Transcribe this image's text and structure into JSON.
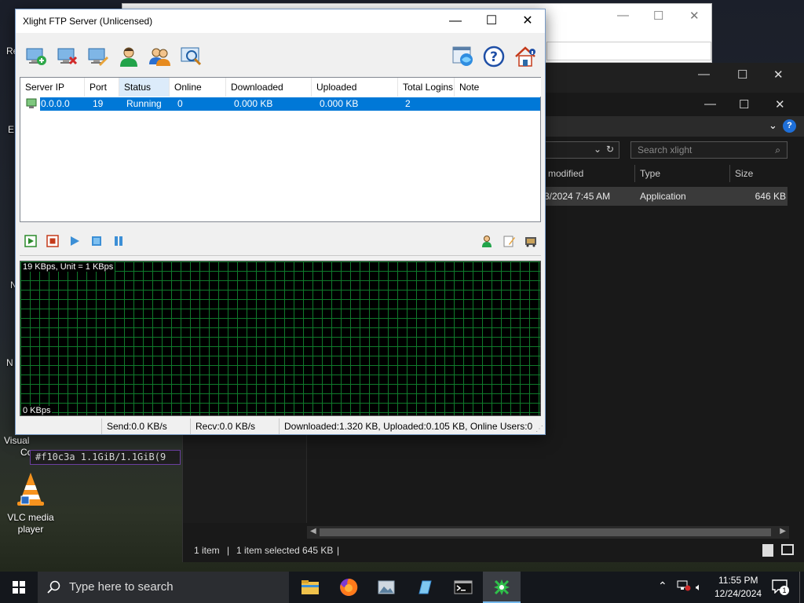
{
  "desktop": {
    "icons": [
      {
        "label": "VLC media player"
      }
    ],
    "partial_labels": [
      "Re",
      "E",
      "N",
      "N",
      "Visual",
      "Co"
    ],
    "terminal_strip": "#f10c3a 1.1GiB/1.1GiB(9"
  },
  "explorer": {
    "search_placeholder": "Search xlight",
    "columns": [
      "modified",
      "Type",
      "Size"
    ],
    "file": {
      "modified": "3/2024 7:45 AM",
      "type": "Application",
      "size": "646 KB"
    },
    "status": {
      "count": "1 item",
      "selected": "1 item selected  645 KB"
    }
  },
  "xlight": {
    "title": "Xlight FTP Server (Unlicensed)",
    "toolbar_icons": [
      "add-server-icon",
      "delete-server-icon",
      "edit-server-icon",
      "user-icon",
      "users-group-icon",
      "search-icon",
      "global-settings-icon",
      "help-icon",
      "home-info-icon"
    ],
    "list": {
      "headers": [
        "Server IP",
        "Port",
        "Status",
        "Online Users",
        "Downloaded",
        "Uploaded",
        "Total Logins",
        "Note"
      ],
      "rows": [
        {
          "ip": "0.0.0.0",
          "port": "19",
          "status": "Running",
          "online": "0",
          "downloaded": "0.000 KB",
          "uploaded": "0.000 KB",
          "logins": "2",
          "note": ""
        }
      ]
    },
    "controls": [
      "start-icon",
      "stop-icon",
      "play-icon",
      "stop-blue-icon",
      "pause-icon",
      "user-sessions-icon",
      "notes-icon",
      "log-icon"
    ],
    "graph": {
      "top_label": "19 KBps, Unit = 1 KBps",
      "bottom_label": "0 KBps"
    },
    "status_bar": {
      "send": "Send:0.0 KB/s",
      "recv": "Recv:0.0 KB/s",
      "summary": "Downloaded:1.320 KB, Uploaded:0.105 KB, Online Users:0"
    }
  },
  "taskbar": {
    "search_placeholder": "Type here to search",
    "apps": [
      "file-explorer-icon",
      "firefox-icon",
      "photos-icon",
      "notepad-icon",
      "terminal-icon",
      "xlight-icon"
    ],
    "time": "11:55 PM",
    "date": "12/24/2024",
    "notification_count": "1"
  },
  "colors": {
    "selection": "#0078d7",
    "graph_grid": "#0f7a2b",
    "taskbar": "#14171c"
  }
}
